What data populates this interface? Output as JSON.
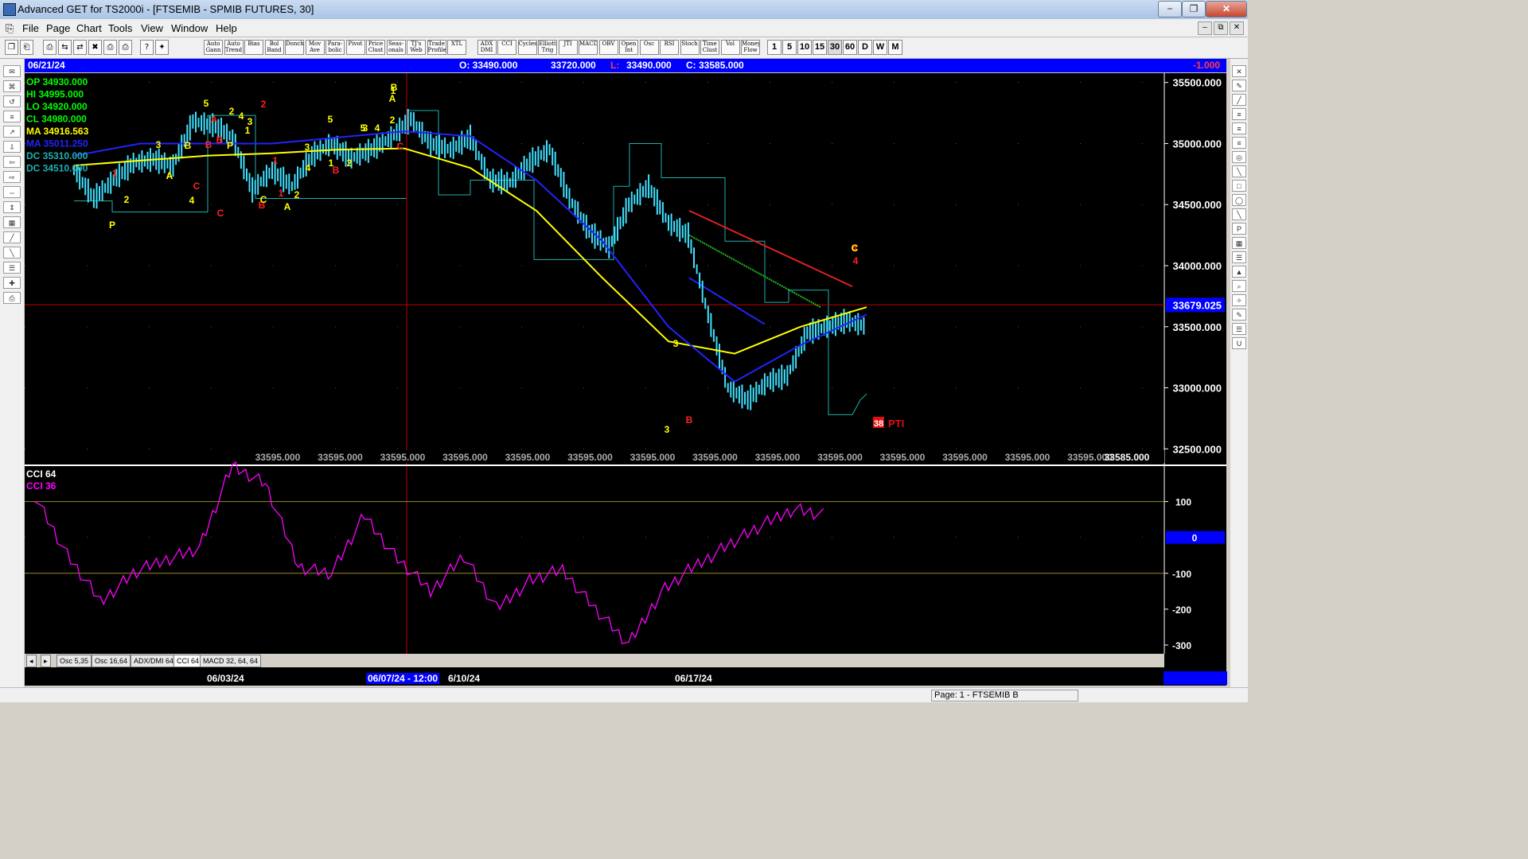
{
  "window": {
    "title": "Advanced GET for TS2000i - [FTSEMIB - SPMIB FUTURES, 30]",
    "minimize": "−",
    "restore": "❐",
    "close": "✕"
  },
  "menu": [
    "File",
    "Page",
    "Chart",
    "Tools",
    "View",
    "Window",
    "Help"
  ],
  "toolbar": {
    "study_buttons": [
      "Auto Gann",
      "Auto Trend",
      "Bias",
      "Bol Band",
      "Donch",
      "Mov Ave",
      "Para-bolic",
      "Pivot",
      "Price Clust",
      "Seas-onals",
      "TJ's Web",
      "Trade Profile",
      "XTL",
      "ADX DMI",
      "CCI",
      "Cycles",
      "Elliott Trig",
      "JTI",
      "MACD",
      "OBV",
      "Open Int",
      "Osc",
      "RSI",
      "Stoch",
      "Time Clust",
      "Vol",
      "Money Flow"
    ],
    "timeframes": [
      "1",
      "5",
      "10",
      "15",
      "30",
      "60",
      "D",
      "W",
      "M"
    ],
    "active_timeframe": "30"
  },
  "header": {
    "date": "06/21/24",
    "open": "O: 33490.000",
    "high": "33720.000",
    "low_label": "L:",
    "low": "33490.000",
    "close": "C: 33585.000",
    "change": "-1.000"
  },
  "legend": [
    {
      "label": "OP  34930.000",
      "color": "#00ff00"
    },
    {
      "label": "HI   34995.000",
      "color": "#00ff00"
    },
    {
      "label": "LO  34920.000",
      "color": "#00ff00"
    },
    {
      "label": "CL  34980.000",
      "color": "#00ff00"
    },
    {
      "label": "MA  34916.563",
      "color": "#ffff00"
    },
    {
      "label": "MA  35011.250",
      "color": "#2222ff"
    },
    {
      "label": "DC  35310.000",
      "color": "#20b0b0"
    },
    {
      "label": "DC  34510.000",
      "color": "#20b0b0"
    }
  ],
  "price_axis": {
    "ticks": [
      "35500.000",
      "35000.000",
      "34500.000",
      "34000.000",
      "33500.000",
      "33000.000",
      "32500.000"
    ],
    "current": "33679.025"
  },
  "price_row": {
    "values": [
      "33595.000",
      "33595.000",
      "33595.000",
      "33595.000",
      "33595.000",
      "33595.000",
      "33595.000",
      "33595.000",
      "33595.000",
      "33595.000",
      "33595.000",
      "33595.000",
      "33595.000",
      "33595.000"
    ],
    "last": "33585.000"
  },
  "pti": {
    "value": "38",
    "label": "PTI"
  },
  "cci_panel": {
    "labels": [
      {
        "text": "CCI 64",
        "color": "#ffffff"
      },
      {
        "text": "CCI  36",
        "color": "#ff00ff"
      }
    ],
    "ticks": [
      "100",
      "0",
      "-100",
      "-200",
      "-300"
    ],
    "zero_label": "0"
  },
  "tabs": [
    "Osc 5,35",
    "Osc 16,64",
    "ADX/DMI 64",
    "CCI 64",
    "MACD 32, 64, 64"
  ],
  "active_tab": "CCI 64",
  "dates": [
    "06/03/24",
    "06/07/24 - 12:00",
    "6/10/24",
    "06/17/24"
  ],
  "status": "Page: 1 - FTSEMIB B",
  "colors": {
    "header_bg": "#0000ff",
    "price_bars": "#40e0ff",
    "ma_fast": "#ffff00",
    "ma_slow": "#2222ff",
    "donchian": "#20b0b0",
    "cci": "#ff00ff",
    "crosshair": "#c00000",
    "elliott_yellow": "#ffff00",
    "elliott_red": "#ff2020"
  },
  "chart_data": {
    "type": "line",
    "title": "FTSEMIB - SPMIB FUTURES, 30",
    "ylim": [
      32450,
      35550
    ],
    "series": [
      {
        "name": "Price",
        "x": [
          0,
          6,
          12,
          18,
          24,
          30,
          36,
          42,
          48,
          54,
          60,
          66,
          72,
          78,
          84,
          90,
          96,
          102,
          108,
          114,
          120,
          126,
          132,
          138,
          144,
          150,
          156,
          162,
          168,
          174,
          180,
          186,
          192,
          198,
          204,
          210,
          216,
          222,
          228,
          234,
          240
        ],
        "values": [
          34780,
          34550,
          34700,
          34840,
          34870,
          34820,
          35180,
          35150,
          35050,
          34620,
          34780,
          34650,
          34900,
          35000,
          34880,
          34950,
          35050,
          35200,
          35000,
          34950,
          35050,
          34700,
          34680,
          34850,
          34950,
          34550,
          34280,
          34150,
          34500,
          34650,
          34350,
          34250,
          33600,
          33000,
          32900,
          33050,
          33100,
          33450,
          33500,
          33550,
          33500
        ]
      },
      {
        "name": "MA",
        "x": [
          0,
          20,
          40,
          60,
          80,
          100,
          120,
          140,
          160,
          180,
          200,
          220,
          240
        ],
        "values": [
          34820,
          34860,
          34900,
          34920,
          34950,
          34960,
          34800,
          34450,
          33900,
          33380,
          33280,
          33500,
          33660
        ]
      },
      {
        "name": "MA",
        "x": [
          0,
          20,
          40,
          60,
          80,
          100,
          120,
          140,
          160,
          180,
          200,
          220,
          240
        ],
        "values": [
          34900,
          35000,
          35000,
          35000,
          35050,
          35100,
          35060,
          34700,
          34200,
          33500,
          33050,
          33350,
          33600
        ]
      },
      {
        "name": "CCI",
        "x": [
          0,
          10,
          20,
          30,
          40,
          50,
          60,
          70,
          80,
          90,
          100,
          110,
          120,
          130,
          140,
          150,
          160,
          170,
          180,
          190,
          200,
          210,
          220,
          230,
          240
        ],
        "values": [
          120,
          -50,
          -180,
          -100,
          -60,
          -30,
          200,
          150,
          -80,
          -100,
          60,
          -60,
          -150,
          -50,
          -200,
          -120,
          -90,
          -200,
          -300,
          -150,
          -80,
          -20,
          30,
          80,
          60
        ]
      }
    ],
    "elliott_labels": [
      "5",
      "A",
      "B",
      "C",
      "2",
      "4",
      "3",
      "1",
      "2",
      "A",
      "B",
      "C",
      "P",
      "1",
      "2",
      "4",
      "3",
      "5",
      "B",
      "C",
      "2",
      "1",
      "4",
      "3",
      "A",
      "B",
      "5",
      "1",
      "2",
      "3",
      "4",
      "1",
      "A",
      "B",
      "P",
      "2",
      "1",
      "C",
      "B",
      "A",
      "3",
      "B",
      "3",
      "4",
      "4",
      "C"
    ]
  }
}
